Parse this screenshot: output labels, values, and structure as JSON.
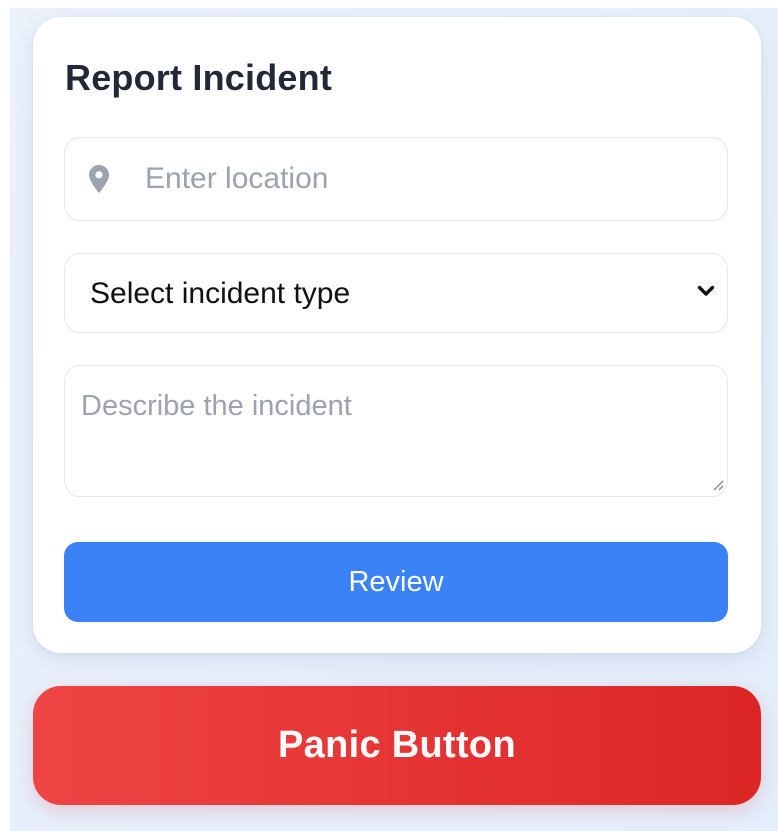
{
  "report_form": {
    "title": "Report Incident",
    "location": {
      "icon": "map-pin-icon",
      "value": "",
      "placeholder": "Enter location"
    },
    "incident_type": {
      "selected_label": "Select incident type",
      "icon": "chevron-down-icon"
    },
    "description": {
      "value": "",
      "placeholder": "Describe the incident"
    },
    "review_label": "Review"
  },
  "panic": {
    "label": "Panic Button"
  },
  "colors": {
    "page_background": "#e6eefa",
    "card_background": "#ffffff",
    "title_text": "#1f2937",
    "placeholder_text": "#9ca3af",
    "field_border": "#e5e7eb",
    "icon_gray": "#9ca3af",
    "review_button": "#3b82f6",
    "panic_button_start": "#ef4444",
    "panic_button_end": "#dc2626"
  }
}
